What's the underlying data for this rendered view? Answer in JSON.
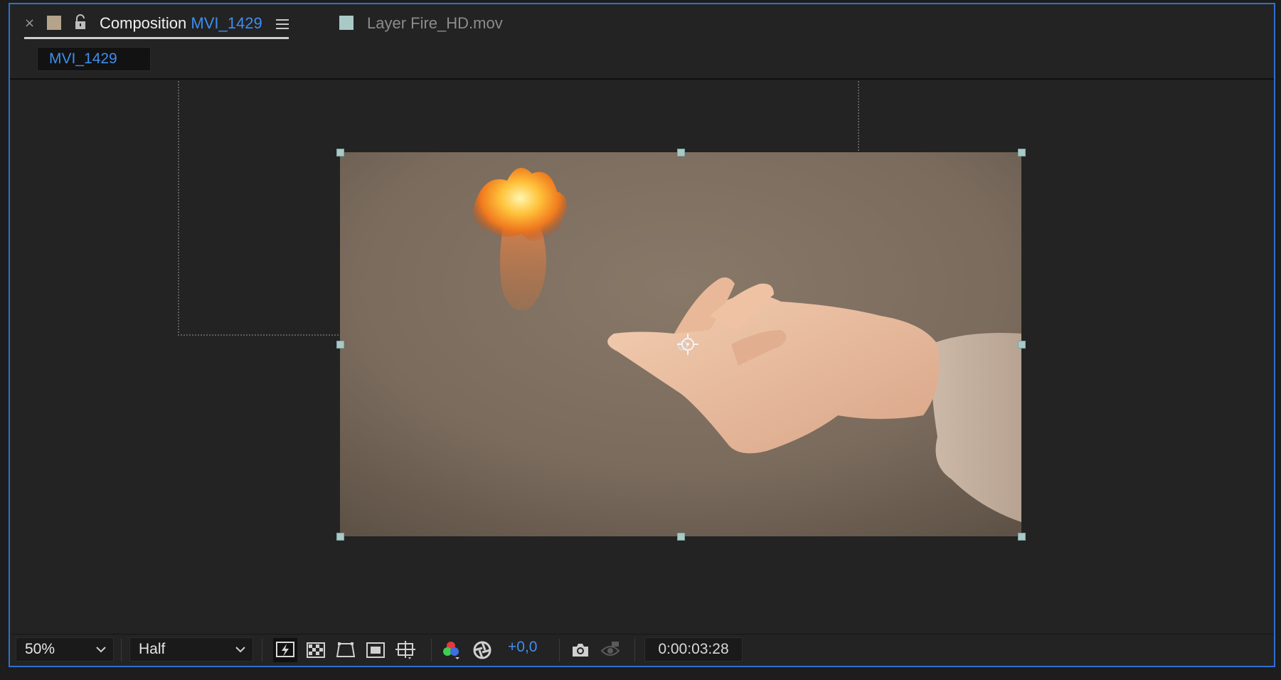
{
  "tab": {
    "close_label": "×",
    "composition_label": "Composition",
    "composition_name": "MVI_1429",
    "layer_tab_label": "Layer Fire_HD.mov"
  },
  "breadcrumb": {
    "label": "MVI_1429"
  },
  "toolbar": {
    "zoom_value": "50%",
    "resolution_value": "Half",
    "exposure_value": "+0,0",
    "timecode": "0:00:03:28"
  },
  "colors": {
    "accent": "#3d8ef0",
    "composition_swatch": "#b5a48a",
    "layer_swatch": "#a9c9c7",
    "handle": "#a9c9c7",
    "panel_border": "#2f6fd2"
  },
  "icons": [
    "close-icon",
    "lock-icon",
    "panel-menu-icon",
    "fast-previews-icon",
    "transparency-grid-icon",
    "mask-visibility-icon",
    "region-of-interest-icon",
    "grid-guides-icon",
    "channel-icon",
    "exposure-reset-icon",
    "snapshot-icon",
    "show-snapshot-icon",
    "chevron-down-icon"
  ]
}
